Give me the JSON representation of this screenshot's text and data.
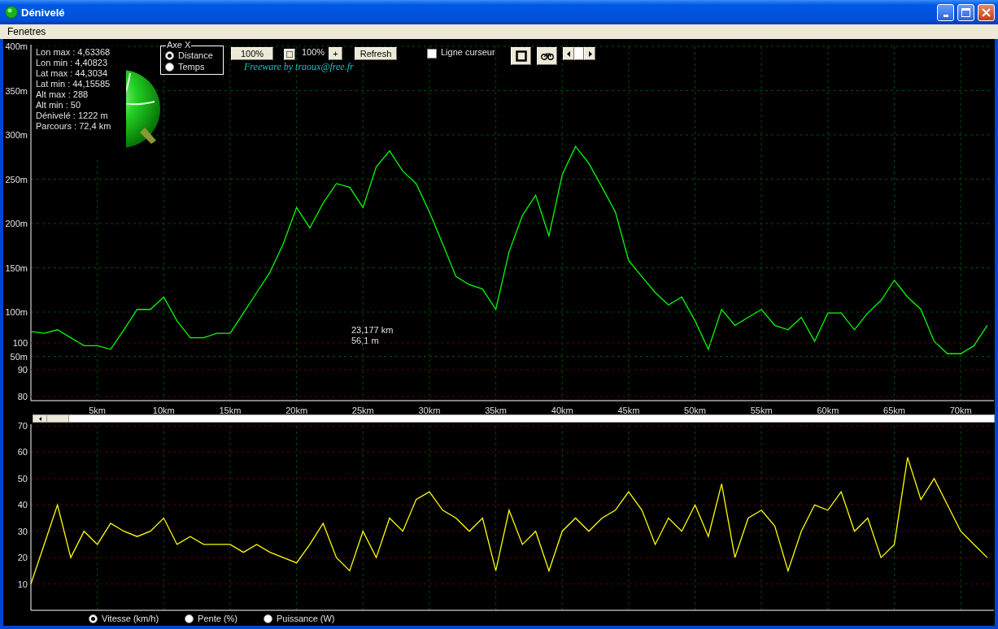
{
  "window": {
    "title": "Dénivelé"
  },
  "menu": [
    {
      "label": "Fenetres"
    }
  ],
  "info": [
    "Lon max : 4,63368",
    "Lon min : 4,40823",
    "Lat max : 44,3034",
    "Lat min : 44,15585",
    "Alt max : 288",
    "Alt min : 50",
    "Dénivelé : 1222 m",
    "Parcours : 72,4 km"
  ],
  "axe_x": {
    "title": "Axe X",
    "options": [
      {
        "label": "Distance",
        "selected": true
      },
      {
        "label": "Temps",
        "selected": false
      }
    ]
  },
  "toolbar": {
    "zoom_button": "100%",
    "zoom_value": "100%",
    "plus_button": "+",
    "refresh_button": "Refresh",
    "credit": "Freeware by traoux@free.fr",
    "cursor_line": {
      "label": "Ligne curseur",
      "checked": false
    }
  },
  "cursor_readout": [
    "23,177 km",
    "56,1 m"
  ],
  "elevation": {
    "secondary_axis_labels": [
      "100",
      "90",
      "80"
    ],
    "chart_data": {
      "type": "line",
      "grid": true,
      "x": [
        0,
        1,
        2,
        3,
        4,
        5,
        6,
        7,
        8,
        9,
        10,
        11,
        12,
        13,
        14,
        15,
        16,
        17,
        18,
        19,
        20,
        21,
        22,
        23,
        24,
        25,
        26,
        27,
        28,
        29,
        30,
        31,
        32,
        33,
        34,
        35,
        36,
        37,
        38,
        39,
        40,
        41,
        42,
        43,
        44,
        45,
        46,
        47,
        48,
        49,
        50,
        51,
        52,
        53,
        54,
        55,
        56,
        57,
        58,
        59,
        60,
        61,
        62,
        63,
        64,
        65,
        66,
        67,
        68,
        69,
        70,
        71,
        72
      ],
      "series": [
        {
          "color": "#00ff00",
          "values": [
            78,
            76,
            80,
            71,
            62,
            62,
            58,
            80,
            103,
            103,
            117,
            90,
            71,
            71,
            76,
            76,
            99,
            122,
            145,
            177,
            218,
            195,
            223,
            245,
            241,
            218,
            264,
            282,
            259,
            245,
            213,
            177,
            140,
            131,
            126,
            103,
            168,
            209,
            232,
            186,
            255,
            287,
            268,
            241,
            213,
            158,
            140,
            122,
            108,
            117,
            90,
            58,
            103,
            85,
            94,
            103,
            85,
            80,
            94,
            67,
            99,
            99,
            80,
            99,
            113,
            136,
            117,
            103,
            67,
            53,
            53,
            62,
            85
          ]
        }
      ],
      "xlim": [
        0,
        72.5
      ],
      "ylim": [
        0,
        400
      ],
      "xticks": [
        {
          "value": 5,
          "label": "5km"
        },
        {
          "value": 10,
          "label": "10km"
        },
        {
          "value": 15,
          "label": "15km"
        },
        {
          "value": 20,
          "label": "20km"
        },
        {
          "value": 25,
          "label": "25km"
        },
        {
          "value": 30,
          "label": "30km"
        },
        {
          "value": 35,
          "label": "35km"
        },
        {
          "value": 40,
          "label": "40km"
        },
        {
          "value": 45,
          "label": "45km"
        },
        {
          "value": 50,
          "label": "50km"
        },
        {
          "value": 55,
          "label": "55km"
        },
        {
          "value": 60,
          "label": "60km"
        },
        {
          "value": 65,
          "label": "65km"
        },
        {
          "value": 70,
          "label": "70km"
        }
      ],
      "yticks": [
        {
          "value": 400,
          "label": "400m"
        },
        {
          "value": 350,
          "label": "350m"
        },
        {
          "value": 300,
          "label": "300m"
        },
        {
          "value": 250,
          "label": "250m"
        },
        {
          "value": 200,
          "label": "200m"
        },
        {
          "value": 150,
          "label": "150m"
        },
        {
          "value": 100,
          "label": "100m"
        },
        {
          "value": 50,
          "label": "50m"
        }
      ]
    }
  },
  "speed": {
    "chart_data": {
      "type": "line",
      "grid": true,
      "x": [
        0,
        1,
        2,
        3,
        4,
        5,
        6,
        7,
        8,
        9,
        10,
        11,
        12,
        13,
        14,
        15,
        16,
        17,
        18,
        19,
        20,
        21,
        22,
        23,
        24,
        25,
        26,
        27,
        28,
        29,
        30,
        31,
        32,
        33,
        34,
        35,
        36,
        37,
        38,
        39,
        40,
        41,
        42,
        43,
        44,
        45,
        46,
        47,
        48,
        49,
        50,
        51,
        52,
        53,
        54,
        55,
        56,
        57,
        58,
        59,
        60,
        61,
        62,
        63,
        64,
        65,
        66,
        67,
        68,
        69,
        70,
        71,
        72
      ],
      "series": [
        {
          "color": "#ffff00",
          "values": [
            10,
            25,
            40,
            20,
            30,
            25,
            33,
            30,
            28,
            30,
            35,
            25,
            28,
            25,
            25,
            25,
            22,
            25,
            22,
            20,
            18,
            25,
            33,
            20,
            15,
            30,
            20,
            35,
            30,
            42,
            45,
            38,
            35,
            30,
            35,
            15,
            38,
            25,
            30,
            15,
            30,
            35,
            30,
            35,
            38,
            45,
            38,
            25,
            35,
            30,
            40,
            28,
            48,
            20,
            35,
            38,
            32,
            15,
            30,
            40,
            38,
            45,
            30,
            35,
            20,
            25,
            58,
            42,
            50,
            40,
            30,
            25,
            20
          ]
        }
      ],
      "xlim": [
        0,
        72.5
      ],
      "ylim": [
        0,
        70
      ],
      "yticks": [
        10,
        20,
        30,
        40,
        50,
        60,
        70
      ]
    }
  },
  "measures": [
    {
      "label": "Vitesse (km/h)",
      "selected": true
    },
    {
      "label": "Pente (%)",
      "selected": false
    },
    {
      "label": "Puissance (W)",
      "selected": false
    }
  ]
}
